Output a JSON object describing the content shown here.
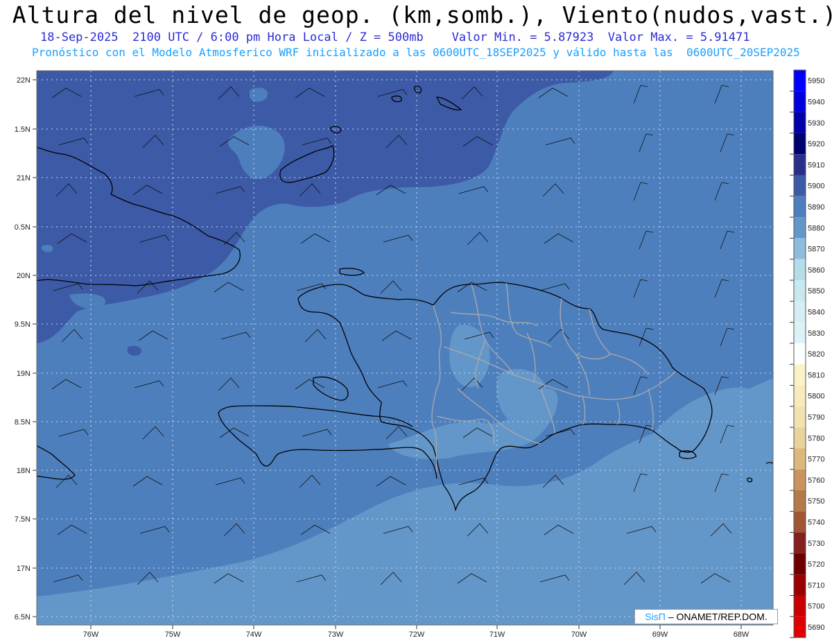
{
  "header": {
    "title": "Altura del nivel de geop. (km,somb.), Viento(nudos,vast.)",
    "subtitle_line1": "18-Sep-2025  2100 UTC / 6:00 pm Hora Local / Z = 500mb    Valor Min. = 5.87923  Valor Max. = 5.91471",
    "subtitle_line2": "Pronóstico con el Modelo Atmosferico WRF inicializado a las 0600UTC_18SEP2025 y válido hasta las  0600UTC_20SEP2025"
  },
  "map": {
    "lat_labels": [
      "22N",
      "1.5N",
      "21N",
      "0.5N",
      "20N",
      "9.5N",
      "19N",
      "8.5N",
      "18N",
      "7.5N",
      "17N",
      "6.5N"
    ],
    "lon_labels": [
      "76W",
      "75W",
      "74W",
      "73W",
      "72W",
      "71W",
      "70W",
      "69W",
      "68W"
    ],
    "colors": {
      "dark_band": "#3d5aa6",
      "mid_band": "#4e7fbd",
      "light_band": "#6497c9",
      "coast": "#000000",
      "province": "#aaaaaa"
    }
  },
  "colorbar": {
    "levels": [
      {
        "value": "5950",
        "color": "#0000ff"
      },
      {
        "value": "5940",
        "color": "#0000dd"
      },
      {
        "value": "5930",
        "color": "#0000a8"
      },
      {
        "value": "5920",
        "color": "#000070"
      },
      {
        "value": "5910",
        "color": "#2a2f8a"
      },
      {
        "value": "5900",
        "color": "#3d5aa6"
      },
      {
        "value": "5890",
        "color": "#4e7fbd"
      },
      {
        "value": "5880",
        "color": "#6497c9"
      },
      {
        "value": "5870",
        "color": "#8fbcdd"
      },
      {
        "value": "5860",
        "color": "#b4dde9"
      },
      {
        "value": "5850",
        "color": "#c8e8f0"
      },
      {
        "value": "5840",
        "color": "#d4eef4"
      },
      {
        "value": "5830",
        "color": "#dcf3f6"
      },
      {
        "value": "5820",
        "color": "#ffffff"
      },
      {
        "value": "5810",
        "color": "#fbf2c8"
      },
      {
        "value": "5800",
        "color": "#f7ebbd"
      },
      {
        "value": "5790",
        "color": "#f2e2b0"
      },
      {
        "value": "5780",
        "color": "#ead29c"
      },
      {
        "value": "5770",
        "color": "#dcb87c"
      },
      {
        "value": "5760",
        "color": "#c89560"
      },
      {
        "value": "5750",
        "color": "#b57a4a"
      },
      {
        "value": "5740",
        "color": "#a05535"
      },
      {
        "value": "5730",
        "color": "#852020"
      },
      {
        "value": "5720",
        "color": "#6e0000"
      },
      {
        "value": "5710",
        "color": "#990000"
      },
      {
        "value": "5700",
        "color": "#c80000"
      },
      {
        "value": "5690",
        "color": "#e00000"
      }
    ]
  },
  "credit": {
    "logo_text": "SisΠ",
    "text": "– ONAMET/REP.DOM."
  }
}
